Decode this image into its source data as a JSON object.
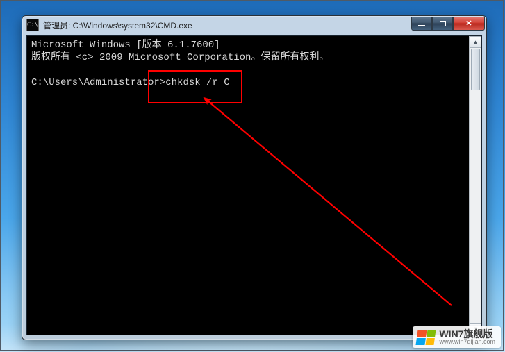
{
  "window": {
    "title": "管理员: C:\\Windows\\system32\\CMD.exe",
    "icon_label": "C:\\"
  },
  "console": {
    "line1": "Microsoft Windows [版本 6.1.7600]",
    "line2": "版权所有 <c> 2009 Microsoft Corporation。保留所有权利。",
    "blank": "",
    "prompt": "C:\\Users\\Administrator>",
    "command": "chkdsk /r C"
  },
  "controls": {
    "minimize": "minimize",
    "maximize": "maximize",
    "close": "close",
    "scroll_up": "▲",
    "scroll_down": "▼"
  },
  "annotation": {
    "label": "highlight-command"
  },
  "watermark": {
    "title": "WIN7旗舰版",
    "url": "www.win7qijian.com"
  }
}
